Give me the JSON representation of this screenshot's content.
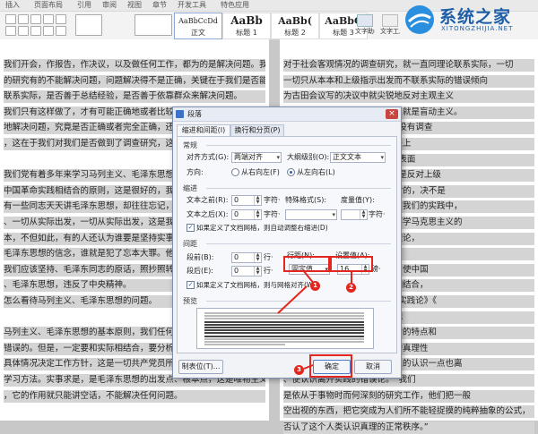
{
  "ribbon": {
    "menus": [
      "插入",
      "页面布局",
      "引用",
      "审阅",
      "视图",
      "章节",
      "开发工具",
      "特色应用"
    ],
    "styles": [
      {
        "preview": "AaBbCcDd",
        "label": "正文"
      },
      {
        "preview": "AaBb",
        "label": "标题 1"
      },
      {
        "preview": "AaBb(",
        "label": "标题 2"
      },
      {
        "preview": "AaBbC",
        "label": "标题 3"
      }
    ],
    "buttons": [
      "文字助手",
      "文字工具"
    ]
  },
  "watermark": {
    "name": "系统之家",
    "url": "XITONGZHIJIA.NET"
  },
  "doc": {
    "left_lines": [
      "我们开会，作报告，作决议，以及做任何工作，都为的是解决问题。我们说",
      "的研究有的不能解决问题，问题解决得不是正确，关键在于我们是否能够理",
      "联系实际，是否善于总结经验，是否善于依靠群众来解决问题。",
      "我们只有这样做了，才有可能正确地或者比较正确地解决问题，这就是",
      "地解决问题，究竟是否正确或者完全正确，还需要今后的实践来检验，证明",
      "，这在于我们对我们是否做到了调查研究，这就是",
      "",
      "我们党有着多年来学习马列主义、毛泽东思想的",
      "中国革命实践相结合的原则，这是很好的，我们一定",
      "有一些同志天天讲毛泽东思想，却往往忘记，抛弃甚至",
      "、一切从实际出发，一切从实际出发，这是我们党的",
      "本，不但如此，有的人还认为谁要是坚持实事求是，",
      "毛泽东思想的信念，谁就是犯了忘本大罪。他们的观点，实质上",
      "我们应该坚持、毛泽东同志的原话，照抄照转照搬就行了。要不",
      "、毛泽东思想，违反了中央精神。",
      "怎么看待马列主义、毛泽东思想的问题。",
      "",
      "马列主义、毛泽东思想的基本原则，我们任何时候都",
      "错误的。但是，一定要和实际相结合，要分析研究实际",
      "具体情况决定工作方针，这是一切共产党员所必须牢牢记",
      "学习方法。实事求是，是毛泽东思想的出发点、根本点，这是唯物主义。不然，",
      "，它的作用就只能讲空话，不能解决任何问题。"
    ],
    "right_lines": [
      "对于社会客观情况的调查研究，就一直同理论联系实际，一切",
      "一切只从本本和上级指示出发而不联系实际的错误倾向",
      "为古田会议写的决议中就尖锐地反对主观主义",
      "，于是就犯了左的或右的错误，就是盲动主义。",
      "对本本主义》这篇文章，提出“没有调查",
      "在共产党内讨论问题的思想方法上",
      "心理。毛泽东同志说：“盲目地表面",
      "”是真正在执行上级的指示，这是反对上级",
      "”又说：“我们说马克思主义是对的，决不是",
      "它提出新的理论。马克思主义在我们的实践中，",
      "学马克思主义的，这就是我们要学马克思主义的",
      "学马克思主义，我们欢迎这个理论，",
      "是马克思主义的精髓和灵魂。",
      "至上神秘的念头在里面。”建立了使中国",
      "，我们必须与中国的具体实际相结合，",
      "《中国革命战争的战略问题》《实践论》《",
      "的思想理论基础。毛泽东同志把",
      "中国的实际情况去研究中国革命的特点和",
      "，才能指导人们对于外界认识的真理性",
      "，才能揭到第一的地位，认为人的认识一点也离",
      "、使认识离开实践的错误论。”“我们",
      "是依从于事物时而何深刻的研究工作，他们把一般",
      "空出视的东西，把它突成为人们所不能轻捉摸的纯粹抽象的公式，",
      "否认了这个人类认识真理的正常秩序。”"
    ]
  },
  "dialog": {
    "title": "段落",
    "tabs": [
      "缩进和间距(I)",
      "换行和分页(P)"
    ],
    "general_label": "常规",
    "align_label": "对齐方式(G):",
    "align_value": "两端对齐",
    "outline_label": "大纲级别(O):",
    "outline_value": "正文文本",
    "direction_label": "方向:",
    "dir_rtl": "从右向左(F)",
    "dir_ltr": "从左向右(L)",
    "indent_label": "缩进",
    "before_text_label": "文本之前(R):",
    "before_text_value": "0",
    "after_text_label": "文本之后(X):",
    "after_text_value": "0",
    "char_unit": "字符·",
    "special_label": "特殊格式(S):",
    "special_value": "",
    "measure_label": "度量值(Y):",
    "measure_unit": "字符·",
    "auto_indent_label": "如果定义了文档网格，则自动调整右缩进(D)",
    "spacing_label": "间距",
    "before_seg_label": "段前(B):",
    "before_seg_value": "0",
    "after_seg_label": "段后(E):",
    "after_seg_value": "0",
    "line_unit": "行·",
    "line_spacing_label": "行距(N):",
    "line_spacing_value": "固定值",
    "set_value_label": "设置值(A):",
    "set_value_value": "16",
    "set_value_unit": "磅·",
    "grid_align_label": "如果定义了文档网格，则与网格对齐(W)",
    "preview_label": "预览",
    "tabs_button": "制表位(T)...",
    "ok_button": "确定",
    "cancel_button": "取消",
    "close": "×"
  },
  "annotations": [
    "1",
    "2",
    "3"
  ],
  "colors": {
    "highlight": "#e3261f",
    "accent": "#2c5fb4"
  }
}
